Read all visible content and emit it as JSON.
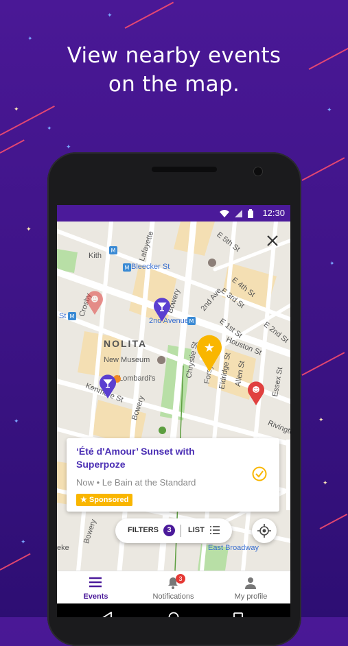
{
  "headline": {
    "line1": "View nearby events",
    "line2": "on the map."
  },
  "statusbar": {
    "time": "12:30"
  },
  "map": {
    "labels": {
      "e5th": "E 5th St",
      "kith": "Kith",
      "bleecker": "Bleecker St",
      "lafayette": "Lafayette",
      "e4th": "E 4th St",
      "e3rd": "E 3rd St",
      "bowery": "Bowery",
      "second_ave": "2nd Ave",
      "second_avenue_station": "2nd Avenue",
      "crosby": "Crosby",
      "st": "St",
      "e1st": "E 1st St",
      "e2nd": "E 2nd St",
      "nolita": "NOLITA",
      "houston": "Houston St",
      "new_museum": "New Museum",
      "lombardis": "Lombardi's",
      "chrystie": "Chrystie St",
      "forsyth": "Forsyth St",
      "eldridge": "Eldridge St",
      "allen": "Allen St",
      "essex": "Essex St",
      "kenmare": "Kenmare St",
      "bowery2": "Bowery",
      "rivington": "Rivington",
      "east_broadway": "East Broadway",
      "bowery3": "Bowery",
      "eke": "eke"
    }
  },
  "event_card": {
    "title": "‘Été d'Amour’ Sunset with Superpoze",
    "subtitle": "Now • Le Bain at the Standard",
    "badge": "Sponsored"
  },
  "controls": {
    "filters_label": "FILTERS",
    "filters_count": "3",
    "list_label": "LIST"
  },
  "bottom_nav": {
    "events": "Events",
    "notifications": "Notifications",
    "notifications_count": "3",
    "profile": "My profile"
  },
  "colors": {
    "accent": "#4b1a9a",
    "pin_blue": "#5b3fd0",
    "pin_red": "#e0403f",
    "pin_gold": "#f9b600"
  }
}
